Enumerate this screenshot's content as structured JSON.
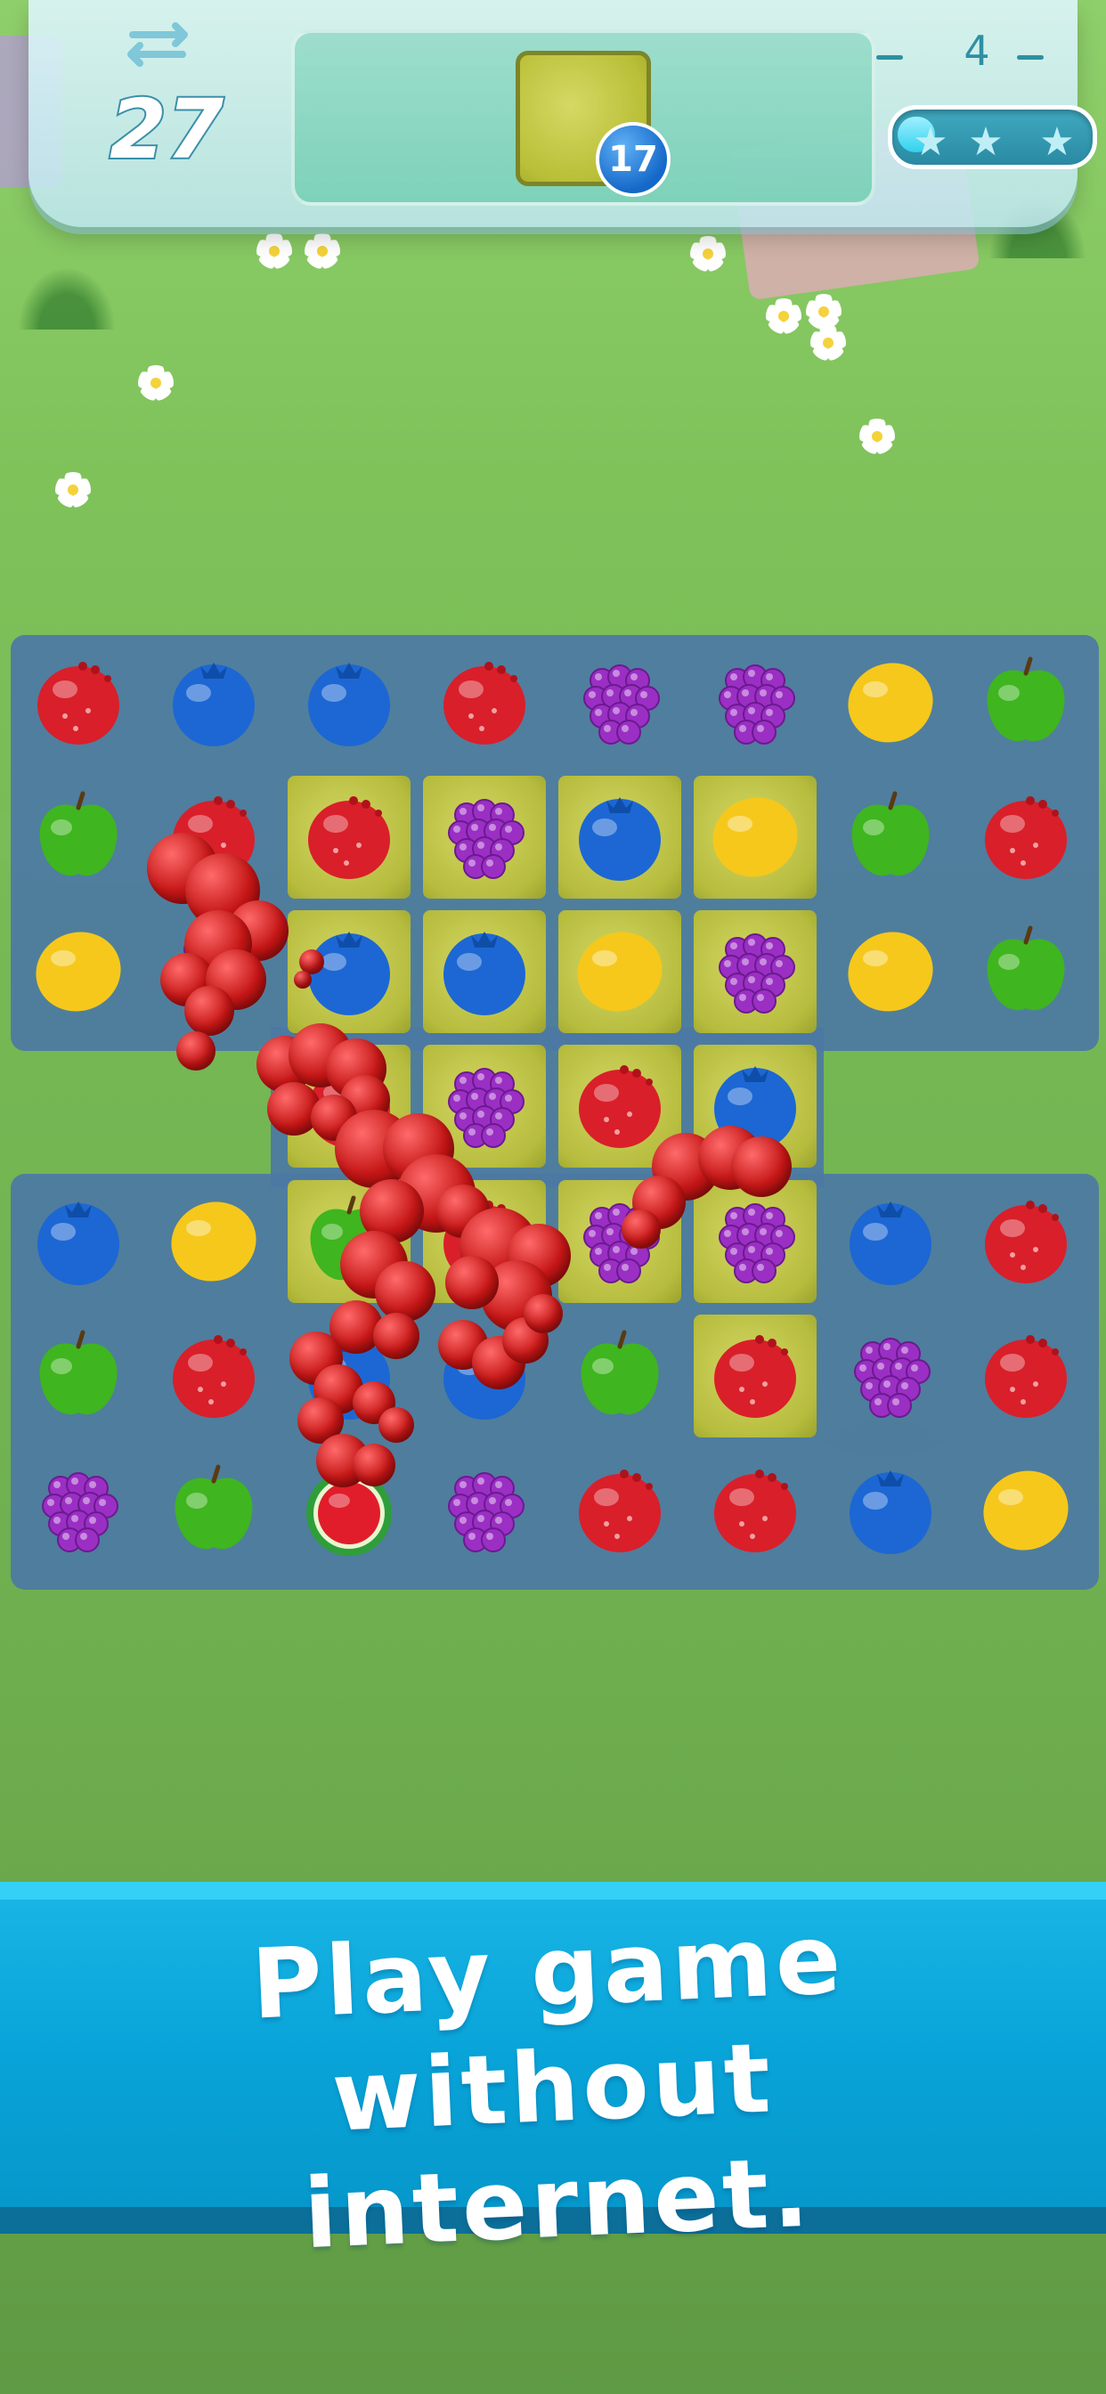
{
  "hud": {
    "moves_left": "27",
    "goal_count": "17",
    "level": "4",
    "star_progress": 0.08
  },
  "icons": {
    "moves": "swap-arrows-icon",
    "goal": "grass-tile-icon",
    "stars": "star-icon"
  },
  "board": {
    "columns": 8,
    "fruits": [
      [
        "strawberry",
        "blueberry",
        "blueberry",
        "strawberry",
        "grape",
        "grape",
        "lemon",
        "apple"
      ],
      [
        "apple",
        "strawberry",
        "strawberry",
        "grape",
        "blueberry",
        "lemon",
        "apple",
        "strawberry"
      ],
      [
        "lemon",
        "grape",
        "blueberry",
        "blueberry",
        "lemon",
        "grape",
        "lemon",
        "apple"
      ],
      [
        null,
        null,
        "strawberry",
        "grape",
        "strawberry",
        "blueberry",
        null,
        null
      ],
      [
        "blueberry",
        "lemon",
        "apple",
        "strawberry",
        "grape",
        "grape",
        "blueberry",
        "strawberry"
      ],
      [
        "apple",
        "strawberry",
        "blueberry",
        "blueberry",
        "apple",
        "strawberry",
        "grape",
        "strawberry"
      ],
      [
        "grape",
        "apple",
        "watermelon",
        "grape",
        "strawberry",
        "strawberry",
        "blueberry",
        "lemon"
      ]
    ],
    "grass_tiles": [
      [
        1,
        2
      ],
      [
        1,
        3
      ],
      [
        1,
        4
      ],
      [
        1,
        5
      ],
      [
        2,
        2
      ],
      [
        2,
        3
      ],
      [
        2,
        4
      ],
      [
        2,
        5
      ],
      [
        3,
        2
      ],
      [
        3,
        3
      ],
      [
        3,
        4
      ],
      [
        3,
        5
      ],
      [
        4,
        2
      ],
      [
        4,
        3
      ],
      [
        4,
        4
      ],
      [
        4,
        5
      ],
      [
        5,
        5
      ]
    ]
  },
  "colors": {
    "strawberry": "#d91f2a",
    "blueberry": "#1c67d4",
    "grape": "#9b2fc4",
    "lemon": "#f6c81b",
    "apple": "#3fb51f",
    "board": "#4c78a4",
    "banner": "#08a3d8"
  },
  "promo": {
    "line1": "Play game without",
    "line2": "internet."
  }
}
